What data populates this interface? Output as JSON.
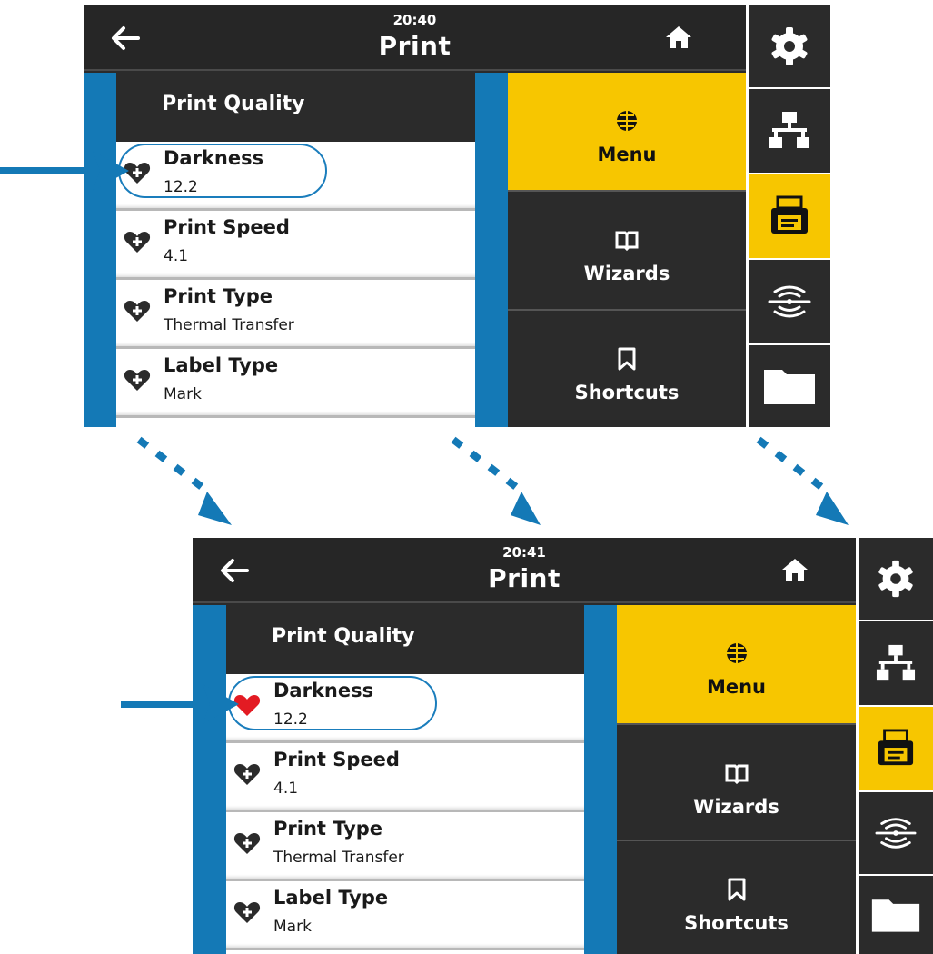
{
  "screens": [
    {
      "time": "20:40",
      "title": "Print",
      "list": {
        "header": "Print Quality",
        "items": [
          {
            "title": "Darkness",
            "value": "12.2",
            "favorite": false
          },
          {
            "title": "Print Speed",
            "value": "4.1",
            "favorite": false
          },
          {
            "title": "Print Type",
            "value": "Thermal Transfer",
            "favorite": false
          },
          {
            "title": "Label Type",
            "value": "Mark",
            "favorite": false
          }
        ]
      },
      "menu": [
        {
          "label": "Menu",
          "icon": "globe-icon",
          "active": true
        },
        {
          "label": "Wizards",
          "icon": "book-icon",
          "active": false
        },
        {
          "label": "Shortcuts",
          "icon": "bookmark-icon",
          "active": false
        }
      ],
      "side": [
        "settings-gear-icon",
        "network-icon",
        "printer-icon",
        "rfid-icon",
        "folder-icon"
      ],
      "side_active": "printer-icon"
    },
    {
      "time": "20:41",
      "title": "Print",
      "list": {
        "header": "Print Quality",
        "items": [
          {
            "title": "Darkness",
            "value": "12.2",
            "favorite": true
          },
          {
            "title": "Print Speed",
            "value": "4.1",
            "favorite": false
          },
          {
            "title": "Print Type",
            "value": "Thermal Transfer",
            "favorite": false
          },
          {
            "title": "Label Type",
            "value": "Mark",
            "favorite": false
          }
        ]
      },
      "menu": [
        {
          "label": "Menu",
          "icon": "globe-icon",
          "active": true
        },
        {
          "label": "Wizards",
          "icon": "book-icon",
          "active": false
        },
        {
          "label": "Shortcuts",
          "icon": "bookmark-icon",
          "active": false
        }
      ],
      "side": [
        "settings-gear-icon",
        "network-icon",
        "printer-icon",
        "rfid-icon",
        "folder-icon"
      ],
      "side_active": "printer-icon"
    }
  ],
  "colors": {
    "accent_yellow": "#f7c600",
    "panel_blue": "#1479b6",
    "favorite_red": "#e31b23",
    "dark_bg": "#2b2b2b"
  }
}
